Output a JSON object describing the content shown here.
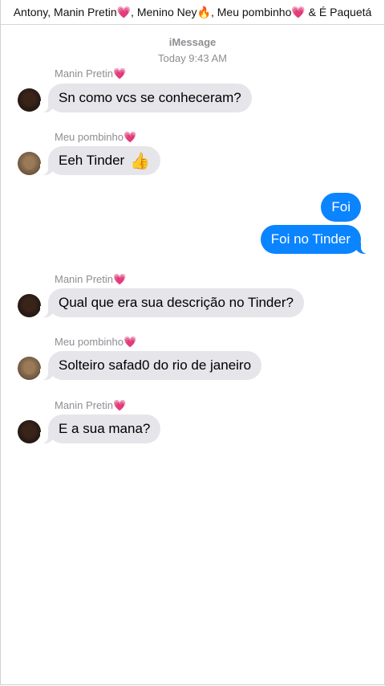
{
  "header": {
    "title": "Antony, Manin Pretin💗, Menino Ney🔥, Meu pombinho💗 & É Paquetá"
  },
  "meta": {
    "service": "iMessage",
    "timestamp": "Today 9:43 AM"
  },
  "messages": [
    {
      "sender": "Manin Pretin💗",
      "text": "Sn como vcs se conheceram?"
    },
    {
      "sender": "Meu pombinho💗",
      "text": "Eeh Tinder",
      "emoji": "👍"
    },
    {
      "text": "Foi"
    },
    {
      "text": "Foi no Tinder"
    },
    {
      "sender": "Manin Pretin💗",
      "text": "Qual que era sua descrição no Tinder?"
    },
    {
      "sender": "Meu pombinho💗",
      "text": "Solteiro safad0 do rio de janeiro"
    },
    {
      "sender": "Manin Pretin💗",
      "text": "E a sua mana?"
    }
  ]
}
